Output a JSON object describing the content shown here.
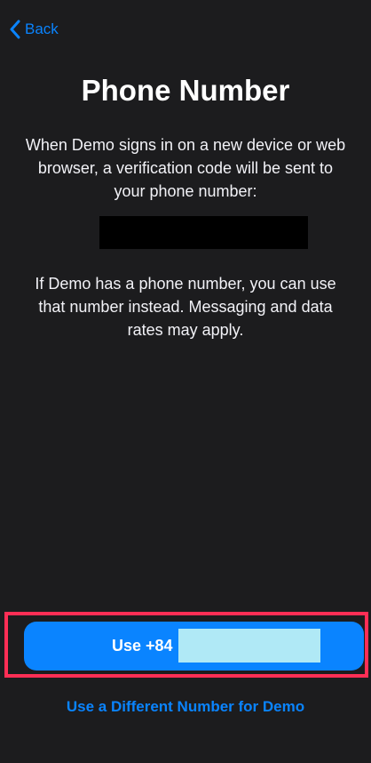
{
  "nav": {
    "back_label": "Back",
    "back_icon": "chevron-left-icon"
  },
  "page": {
    "title": "Phone Number",
    "description_lines": [
      "When Demo signs in on a new device or web",
      "browser, a verification code will be sent to",
      "your phone number:"
    ],
    "alt_description_lines": [
      "If Demo has a phone number, you can use",
      "that number instead. Messaging and data",
      "rates may apply."
    ]
  },
  "actions": {
    "primary_label": "Use +84",
    "secondary_label": "Use a Different Number for Demo"
  },
  "colors": {
    "background": "#1c1c1e",
    "accent": "#0a84ff",
    "highlight": "#ff2e55"
  }
}
